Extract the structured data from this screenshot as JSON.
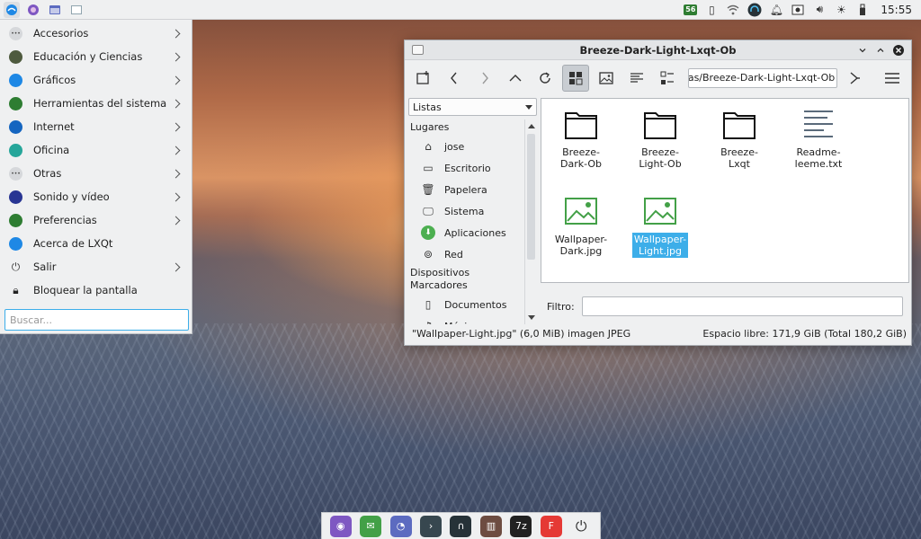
{
  "desktop": {
    "wallpaper": "frost-sunrise"
  },
  "top_panel": {
    "launchers": [
      {
        "icon": "lxqt-menu-icon",
        "color": "#1e88e5"
      },
      {
        "icon": "browser-icon",
        "color": "#7e57c2"
      },
      {
        "icon": "window-icon",
        "color": "#5c6bc0"
      },
      {
        "icon": "file-manager-icon",
        "color": "#90a4ae"
      }
    ],
    "tray": {
      "battery_badge": "56",
      "clock": "15:55"
    }
  },
  "app_menu": {
    "items": [
      {
        "label": "Accesorios",
        "icon": "accessories-icon",
        "color": "#6d6f73",
        "submenu": true
      },
      {
        "label": "Educación y Ciencias",
        "icon": "science-icon",
        "color": "#4e5a3e",
        "submenu": true
      },
      {
        "label": "Gráficos",
        "icon": "graphics-icon",
        "color": "#1e88e5",
        "submenu": true
      },
      {
        "label": "Herramientas del sistema",
        "icon": "system-tools-icon",
        "color": "#2e7d32",
        "submenu": true
      },
      {
        "label": "Internet",
        "icon": "internet-icon",
        "color": "#1565c0",
        "submenu": true
      },
      {
        "label": "Oficina",
        "icon": "office-icon",
        "color": "#26a69a",
        "submenu": true
      },
      {
        "label": "Otras",
        "icon": "other-icon",
        "color": "#6d6f73",
        "submenu": true
      },
      {
        "label": "Sonido y vídeo",
        "icon": "multimedia-icon",
        "color": "#283593",
        "submenu": true
      },
      {
        "label": "Preferencias",
        "icon": "preferences-icon",
        "color": "#2e7d32",
        "submenu": true
      },
      {
        "label": "Acerca de LXQt",
        "icon": "lxqt-about-icon",
        "color": "#1e88e5",
        "submenu": false
      },
      {
        "label": "Salir",
        "icon": "power-icon",
        "color": "#444444",
        "submenu": true
      },
      {
        "label": "Bloquear la pantalla",
        "icon": "lock-icon",
        "color": "#222222",
        "submenu": false
      }
    ],
    "search_placeholder": "Buscar..."
  },
  "file_manager": {
    "title": "Breeze-Dark-Light-Lxqt-Ob",
    "path": "as/Breeze-Dark-Light-Lxqt-Ob",
    "side_mode": "Listas",
    "places_header": "Lugares",
    "places": [
      {
        "label": "jose",
        "icon": "home-icon"
      },
      {
        "label": "Escritorio",
        "icon": "desktop-icon"
      },
      {
        "label": "Papelera",
        "icon": "trash-icon"
      },
      {
        "label": "Sistema",
        "icon": "computer-icon"
      },
      {
        "label": "Aplicaciones",
        "icon": "applications-icon"
      },
      {
        "label": "Red",
        "icon": "network-icon"
      }
    ],
    "devices_header": "Dispositivos",
    "bookmarks_header": "Marcadores",
    "bookmarks": [
      {
        "label": "Documentos",
        "icon": "folder-icon"
      },
      {
        "label": "Música",
        "icon": "music-folder-icon"
      }
    ],
    "files": [
      {
        "name": "Breeze-Dark-Ob",
        "type": "folder",
        "selected": false
      },
      {
        "name": "Breeze-Light-Ob",
        "type": "folder",
        "selected": false
      },
      {
        "name": "Breeze-Lxqt",
        "type": "folder",
        "selected": false
      },
      {
        "name": "Readme-leeme.txt",
        "type": "text",
        "selected": false
      },
      {
        "name": "Wallpaper-Dark.jpg",
        "type": "image",
        "selected": false
      },
      {
        "name": "Wallpaper-Light.jpg",
        "type": "image",
        "selected": true
      }
    ],
    "filter_label": "Filtro:",
    "filter_value": "",
    "status_selected": "\"Wallpaper-Light.jpg\" (6,0 MiB) imagen JPEG",
    "status_free": "Espacio libre: 171,9 GiB (Total 180,2 GiB)"
  },
  "dock": {
    "items": [
      {
        "icon": "browser-icon",
        "color": "#7e57c2"
      },
      {
        "icon": "mail-icon",
        "color": "#43a047"
      },
      {
        "icon": "chat-icon",
        "color": "#5c6bc0"
      },
      {
        "icon": "terminal-icon",
        "color": "#37474f"
      },
      {
        "icon": "headphones-icon",
        "color": "#263238"
      },
      {
        "icon": "library-icon",
        "color": "#6d4c41"
      },
      {
        "icon": "archive-icon",
        "color": "#212121"
      },
      {
        "icon": "editor-icon",
        "color": "#e53935"
      },
      {
        "icon": "power-icon",
        "color": "#444444"
      }
    ]
  }
}
